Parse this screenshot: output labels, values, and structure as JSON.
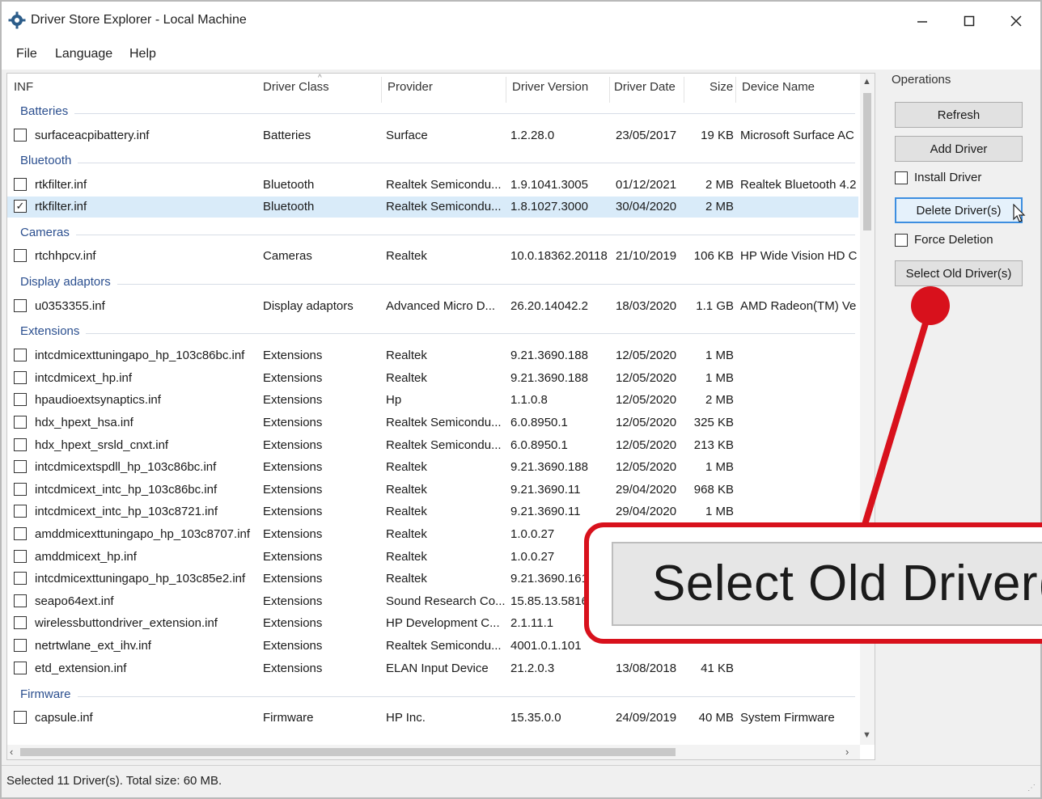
{
  "window": {
    "title": "Driver Store Explorer - Local Machine"
  },
  "menu": [
    "File",
    "Language",
    "Help"
  ],
  "columns": {
    "inf": "INF",
    "driver_class": "Driver Class",
    "provider": "Provider",
    "driver_version": "Driver Version",
    "driver_date": "Driver Date",
    "size": "Size",
    "device_name": "Device Name"
  },
  "groups": {
    "batteries": "Batteries",
    "bluetooth": "Bluetooth",
    "cameras": "Cameras",
    "display_adaptors": "Display adaptors",
    "extensions": "Extensions",
    "firmware": "Firmware"
  },
  "rows": [
    {
      "inf": "surfaceacpibattery.inf",
      "class": "Batteries",
      "provider": "Surface",
      "version": "1.2.28.0",
      "date": "23/05/2017",
      "size": "19 KB",
      "device": "Microsoft Surface AC",
      "checked": false
    },
    {
      "inf": "rtkfilter.inf",
      "class": "Bluetooth",
      "provider": "Realtek Semicondu...",
      "version": "1.9.1041.3005",
      "date": "01/12/2021",
      "size": "2 MB",
      "device": "Realtek Bluetooth 4.2",
      "checked": false
    },
    {
      "inf": "rtkfilter.inf",
      "class": "Bluetooth",
      "provider": "Realtek Semicondu...",
      "version": "1.8.1027.3000",
      "date": "30/04/2020",
      "size": "2 MB",
      "device": "",
      "checked": true
    },
    {
      "inf": "rtchhpcv.inf",
      "class": "Cameras",
      "provider": "Realtek",
      "version": "10.0.18362.20118",
      "date": "21/10/2019",
      "size": "106 KB",
      "device": "HP Wide Vision HD C",
      "checked": false
    },
    {
      "inf": "u0353355.inf",
      "class": "Display adaptors",
      "provider": "Advanced Micro D...",
      "version": "26.20.14042.2",
      "date": "18/03/2020",
      "size": "1.1 GB",
      "device": "AMD Radeon(TM) Ve",
      "checked": false
    },
    {
      "inf": "intcdmicexttuningapo_hp_103c86bc.inf",
      "class": "Extensions",
      "provider": "Realtek",
      "version": "9.21.3690.188",
      "date": "12/05/2020",
      "size": "1 MB",
      "device": "",
      "checked": false
    },
    {
      "inf": "intcdmicext_hp.inf",
      "class": "Extensions",
      "provider": "Realtek",
      "version": "9.21.3690.188",
      "date": "12/05/2020",
      "size": "1 MB",
      "device": "",
      "checked": false
    },
    {
      "inf": "hpaudioextsynaptics.inf",
      "class": "Extensions",
      "provider": "Hp",
      "version": "1.1.0.8",
      "date": "12/05/2020",
      "size": "2 MB",
      "device": "",
      "checked": false
    },
    {
      "inf": "hdx_hpext_hsa.inf",
      "class": "Extensions",
      "provider": "Realtek Semicondu...",
      "version": "6.0.8950.1",
      "date": "12/05/2020",
      "size": "325 KB",
      "device": "",
      "checked": false
    },
    {
      "inf": "hdx_hpext_srsld_cnxt.inf",
      "class": "Extensions",
      "provider": "Realtek Semicondu...",
      "version": "6.0.8950.1",
      "date": "12/05/2020",
      "size": "213 KB",
      "device": "",
      "checked": false
    },
    {
      "inf": "intcdmicextspdll_hp_103c86bc.inf",
      "class": "Extensions",
      "provider": "Realtek",
      "version": "9.21.3690.188",
      "date": "12/05/2020",
      "size": "1 MB",
      "device": "",
      "checked": false
    },
    {
      "inf": "intcdmicext_intc_hp_103c86bc.inf",
      "class": "Extensions",
      "provider": "Realtek",
      "version": "9.21.3690.11",
      "date": "29/04/2020",
      "size": "968 KB",
      "device": "",
      "checked": false
    },
    {
      "inf": "intcdmicext_intc_hp_103c8721.inf",
      "class": "Extensions",
      "provider": "Realtek",
      "version": "9.21.3690.11",
      "date": "29/04/2020",
      "size": "1 MB",
      "device": "",
      "checked": false
    },
    {
      "inf": "amddmicexttuningapo_hp_103c8707.inf",
      "class": "Extensions",
      "provider": "Realtek",
      "version": "1.0.0.27",
      "date": "",
      "size": "",
      "device": "",
      "checked": false
    },
    {
      "inf": "amddmicext_hp.inf",
      "class": "Extensions",
      "provider": "Realtek",
      "version": "1.0.0.27",
      "date": "",
      "size": "",
      "device": "",
      "checked": false
    },
    {
      "inf": "intcdmicexttuningapo_hp_103c85e2.inf",
      "class": "Extensions",
      "provider": "Realtek",
      "version": "9.21.3690.161",
      "date": "",
      "size": "",
      "device": "",
      "checked": false
    },
    {
      "inf": "seapo64ext.inf",
      "class": "Extensions",
      "provider": "Sound Research Co...",
      "version": "15.85.13.5816",
      "date": "",
      "size": "",
      "device": "",
      "checked": false
    },
    {
      "inf": "wirelessbuttondriver_extension.inf",
      "class": "Extensions",
      "provider": "HP Development C...",
      "version": "2.1.11.1",
      "date": "",
      "size": "",
      "device": "",
      "checked": false
    },
    {
      "inf": "netrtwlane_ext_ihv.inf",
      "class": "Extensions",
      "provider": "Realtek Semicondu...",
      "version": "4001.0.1.101",
      "date": "",
      "size": "",
      "device": "",
      "checked": false
    },
    {
      "inf": "etd_extension.inf",
      "class": "Extensions",
      "provider": "ELAN Input Device",
      "version": "21.2.0.3",
      "date": "13/08/2018",
      "size": "41 KB",
      "device": "",
      "checked": false
    },
    {
      "inf": "capsule.inf",
      "class": "Firmware",
      "provider": "HP Inc.",
      "version": "15.35.0.0",
      "date": "24/09/2019",
      "size": "40 MB",
      "device": "System Firmware",
      "checked": false
    }
  ],
  "operations": {
    "title": "Operations",
    "refresh": "Refresh",
    "add_driver": "Add Driver",
    "install_driver": "Install Driver",
    "delete_drivers": "Delete Driver(s)",
    "force_deletion": "Force Deletion",
    "select_old_drivers": "Select Old Driver(s)"
  },
  "status": "Selected 11 Driver(s). Total size: 60 MB.",
  "callout": {
    "text": "Select Old Driver(s)",
    "color": "#d8111c"
  },
  "colors": {
    "selection": "#d9ebf9",
    "group_text": "#2b4f8f",
    "accent": "#d8111c"
  }
}
